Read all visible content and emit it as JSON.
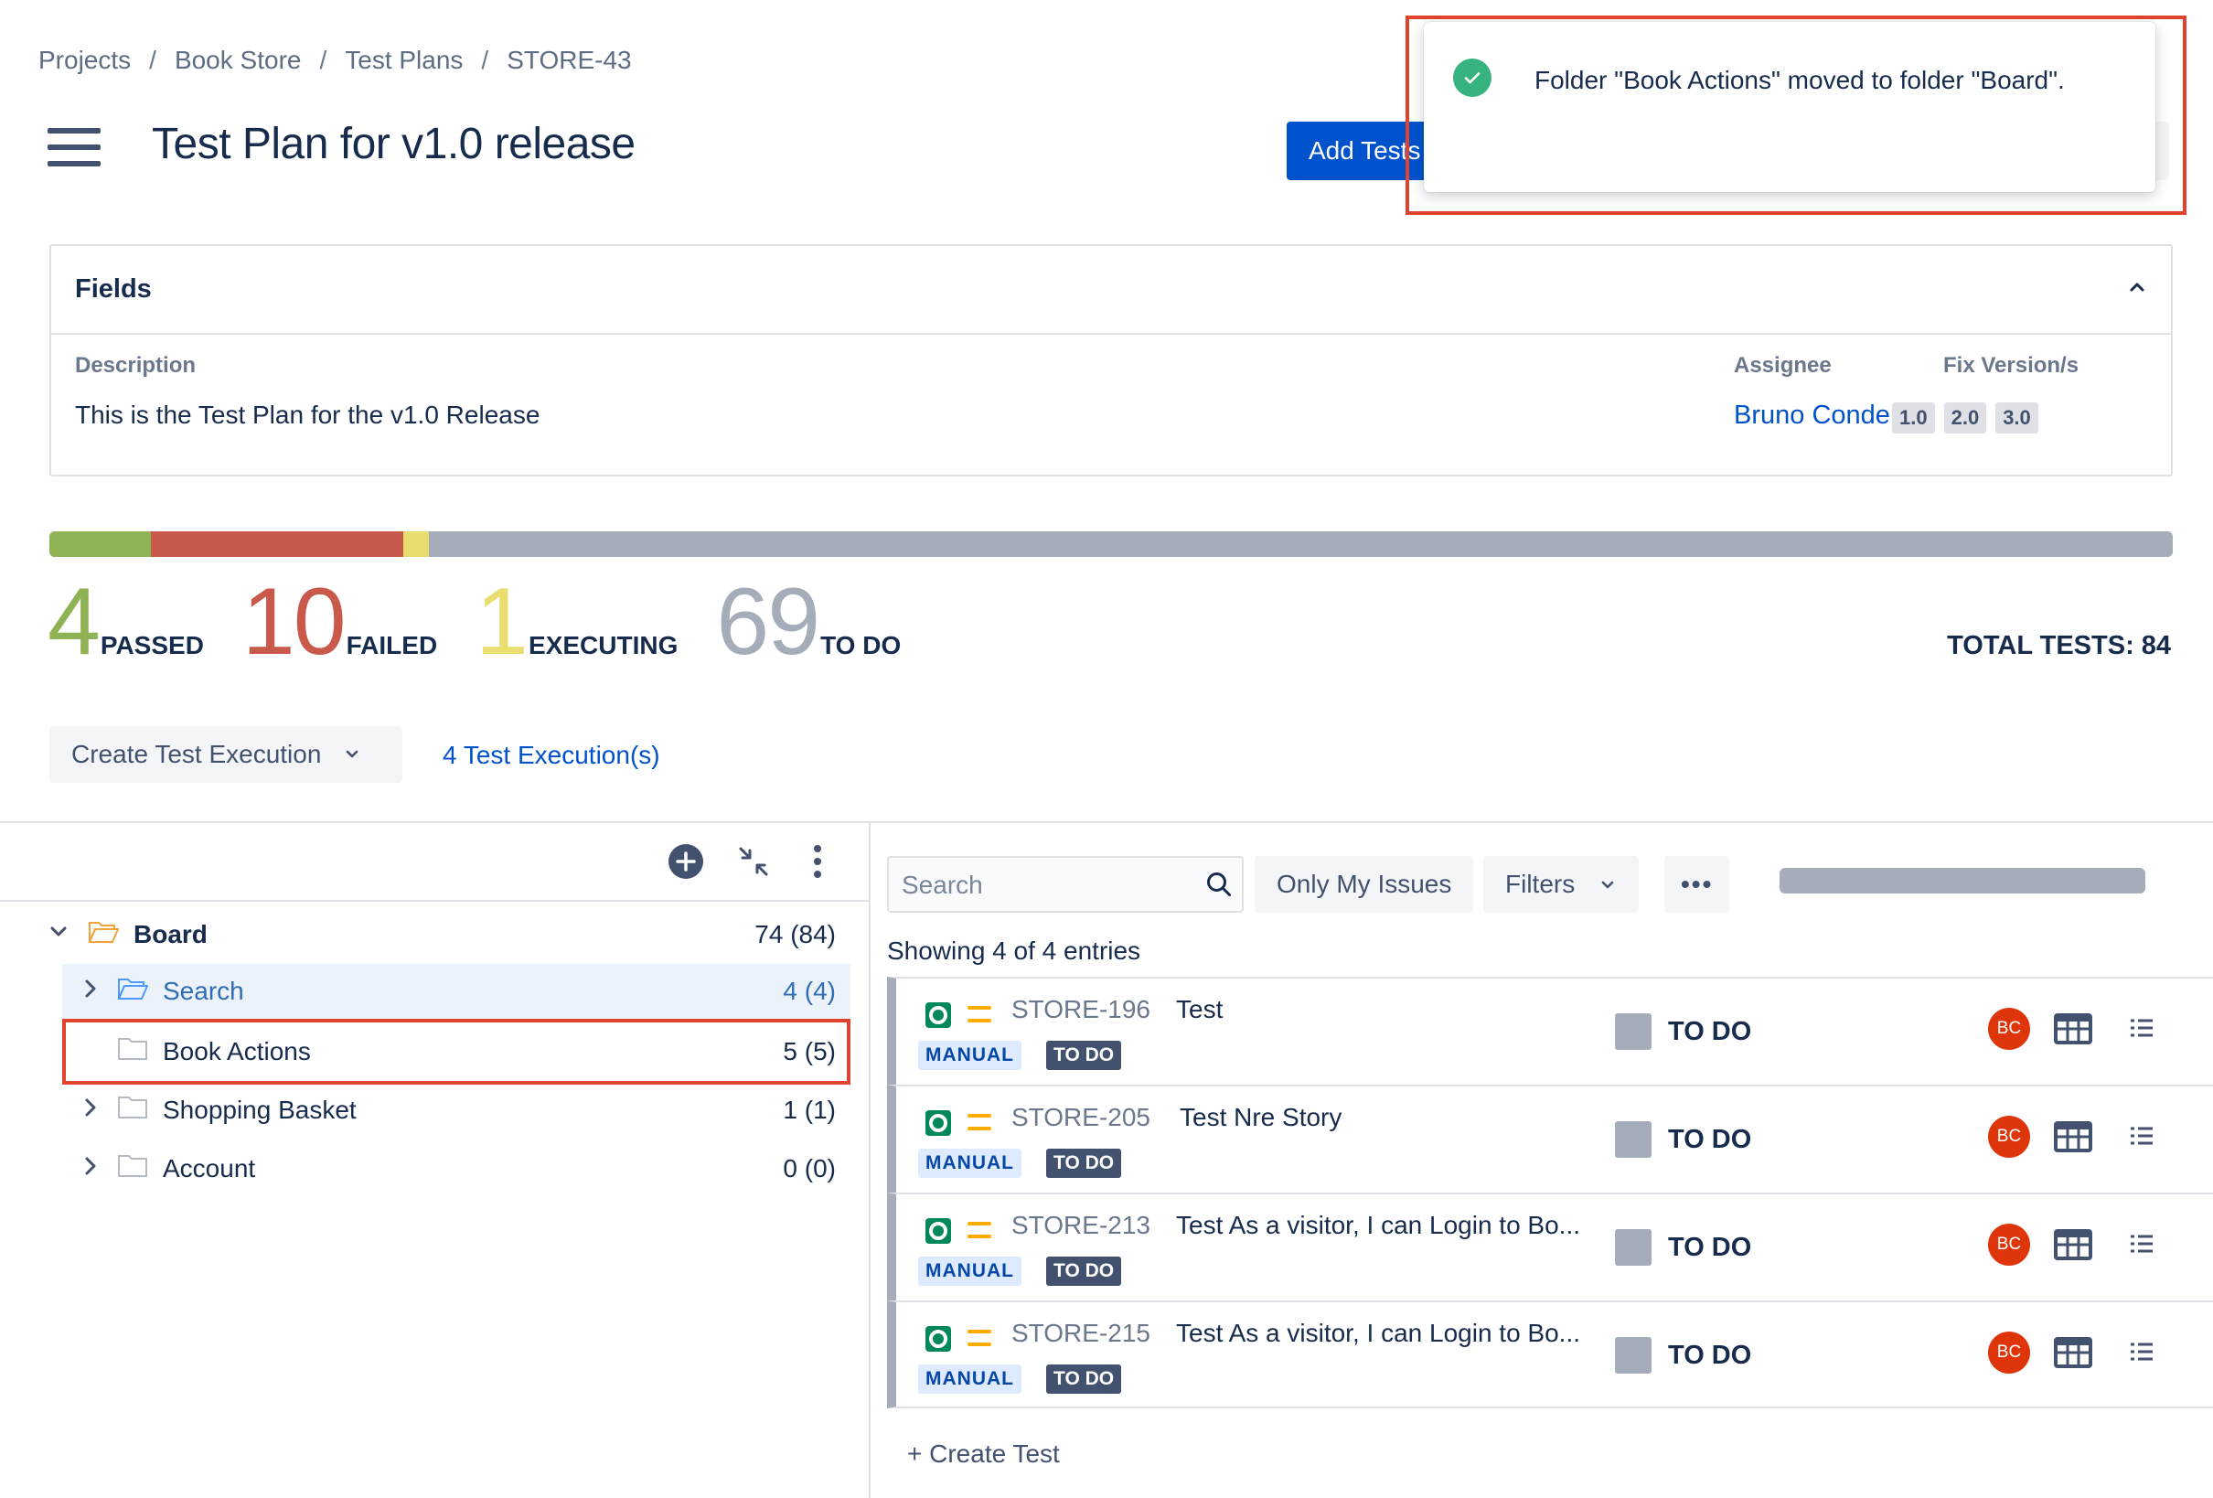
{
  "breadcrumb": [
    "Projects",
    "Book Store",
    "Test Plans",
    "STORE-43"
  ],
  "breadcrumb_separator": "/",
  "title": "Test Plan for v1.0 release",
  "add_tests_label": "Add Tests",
  "toast": {
    "icon": "check-circle-icon",
    "message": "Folder \"Book Actions\" moved to folder \"Board\"."
  },
  "fields": {
    "header": "Fields",
    "description_label": "Description",
    "description_value": "This is the Test Plan for the v1.0 Release",
    "assignee_label": "Assignee",
    "assignee_value": "Bruno Conde",
    "fix_versions_label": "Fix Version/s",
    "fix_versions": [
      "1.0",
      "2.0",
      "3.0"
    ]
  },
  "stats": {
    "passed": {
      "count": "4",
      "label": "PASSED",
      "color": "#8fb254"
    },
    "failed": {
      "count": "10",
      "label": "FAILED",
      "color": "#c9594a"
    },
    "executing": {
      "count": "1",
      "label": "EXECUTING",
      "color": "#e8de6e"
    },
    "todo": {
      "count": "69",
      "label": "TO DO",
      "color": "#a5adba"
    },
    "total_label": "TOTAL TESTS:",
    "total_value": "84"
  },
  "create_execution_label": "Create Test Execution",
  "executions_link": "4 Test Execution(s)",
  "tree": {
    "root": {
      "name": "Board",
      "count": "74 (84)"
    },
    "children": [
      {
        "name": "Search",
        "count": "4 (4)",
        "selected": true
      },
      {
        "name": "Book Actions",
        "count": "5 (5)"
      },
      {
        "name": "Shopping Basket",
        "count": "1 (1)"
      },
      {
        "name": "Account",
        "count": "0 (0)"
      }
    ]
  },
  "search": {
    "placeholder": "Search"
  },
  "only_my_issues_label": "Only My Issues",
  "filters_label": "Filters",
  "more_label": "•••",
  "showing_text": "Showing 4 of 4 entries",
  "issues": [
    {
      "key": "STORE-196",
      "summary": "Test",
      "type_tag": "MANUAL",
      "status_tag": "TO DO",
      "status": "TO DO",
      "assignee": "BC"
    },
    {
      "key": "STORE-205",
      "summary": "Test Nre Story",
      "type_tag": "MANUAL",
      "status_tag": "TO DO",
      "status": "TO DO",
      "assignee": "BC"
    },
    {
      "key": "STORE-213",
      "summary": "Test As a visitor, I can Login to Bo...",
      "type_tag": "MANUAL",
      "status_tag": "TO DO",
      "status": "TO DO",
      "assignee": "BC"
    },
    {
      "key": "STORE-215",
      "summary": "Test As a visitor, I can Login to Bo...",
      "type_tag": "MANUAL",
      "status_tag": "TO DO",
      "status": "TO DO",
      "assignee": "BC"
    }
  ],
  "create_test_label": "+ Create Test"
}
